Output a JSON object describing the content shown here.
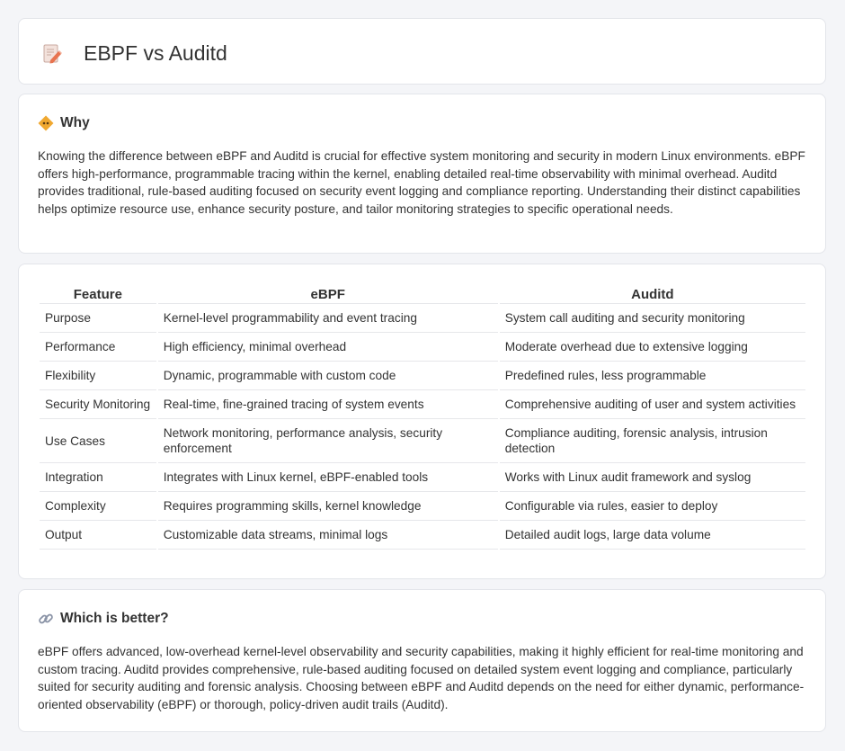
{
  "header": {
    "icon": "document-pencil-icon",
    "title": "EBPF vs Auditd"
  },
  "why": {
    "icon": "diamond-warning-icon",
    "title": "Why",
    "text": "Knowing the difference between eBPF and Auditd is crucial for effective system monitoring and security in modern Linux environments. eBPF offers high-performance, programmable tracing within the kernel, enabling detailed real-time observability with minimal overhead. Auditd provides traditional, rule-based auditing focused on security event logging and compliance reporting. Understanding their distinct capabilities helps optimize resource use, enhance security posture, and tailor monitoring strategies to specific operational needs."
  },
  "table": {
    "headers": [
      "Feature",
      "eBPF",
      "Auditd"
    ],
    "rows": [
      [
        "Purpose",
        "Kernel-level programmability and event tracing",
        "System call auditing and security monitoring"
      ],
      [
        "Performance",
        "High efficiency, minimal overhead",
        "Moderate overhead due to extensive logging"
      ],
      [
        "Flexibility",
        "Dynamic, programmable with custom code",
        "Predefined rules, less programmable"
      ],
      [
        "Security Monitoring",
        "Real-time, fine-grained tracing of system events",
        "Comprehensive auditing of user and system activities"
      ],
      [
        "Use Cases",
        "Network monitoring, performance analysis, security enforcement",
        "Compliance auditing, forensic analysis, intrusion detection"
      ],
      [
        "Integration",
        "Integrates with Linux kernel, eBPF-enabled tools",
        "Works with Linux audit framework and syslog"
      ],
      [
        "Complexity",
        "Requires programming skills, kernel knowledge",
        "Configurable via rules, easier to deploy"
      ],
      [
        "Output",
        "Customizable data streams, minimal logs",
        "Detailed audit logs, large data volume"
      ]
    ]
  },
  "better": {
    "icon": "link-icon",
    "title": "Which is better?",
    "text": "eBPF offers advanced, low-overhead kernel-level observability and security capabilities, making it highly efficient for real-time monitoring and custom tracing. Auditd provides comprehensive, rule-based auditing focused on detailed system event logging and compliance, particularly suited for security auditing and forensic analysis. Choosing between eBPF and Auditd depends on the need for either dynamic, performance-oriented observability (eBPF) or thorough, policy-driven audit trails (Auditd)."
  }
}
